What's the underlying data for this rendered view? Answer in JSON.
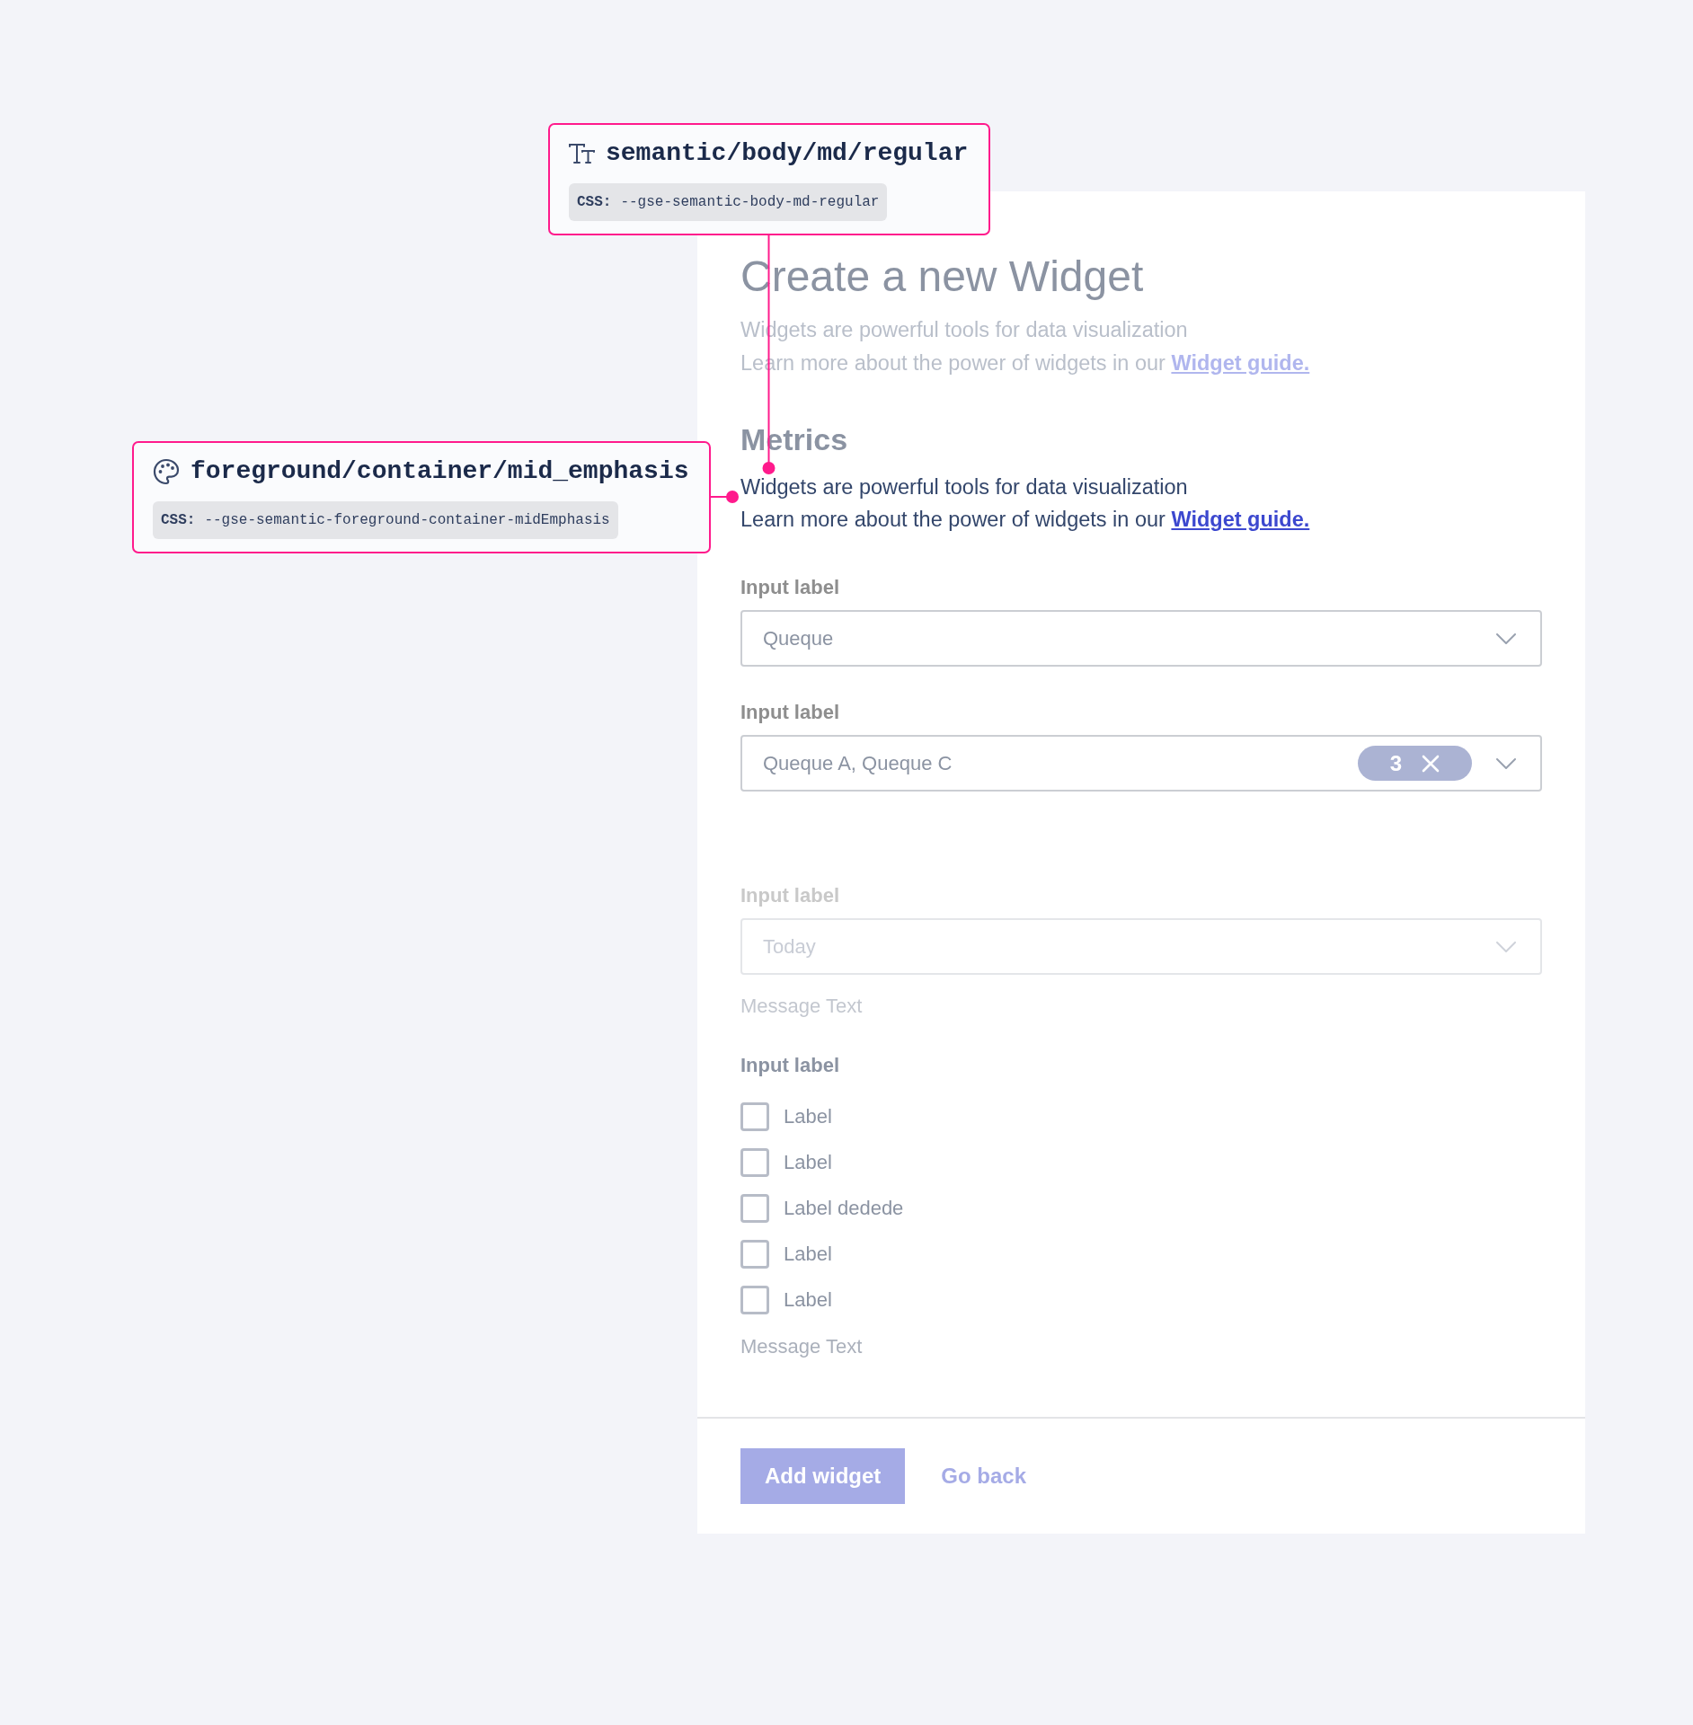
{
  "annotations": [
    {
      "kind": "typography",
      "title": "semantic/body/md/regular",
      "css_label": "CSS:",
      "css_value": "--gse-semantic-body-md-regular"
    },
    {
      "kind": "color",
      "title": "foreground/container/mid_emphasis",
      "css_label": "CSS:",
      "css_value": "--gse-semantic-foreground-container-midEmphasis"
    }
  ],
  "form": {
    "title": "Create a new Widget",
    "intro": {
      "muted": true,
      "line_1": "Widgets are powerful tools for data visualization",
      "line_2": "Learn more about the power of widgets in our",
      "link": "Widget guide."
    },
    "section_heading": "Metrics",
    "description": {
      "muted": false,
      "line_1": "Widgets are powerful tools for data visualization",
      "line_2": "Learn more about the power of widgets in our",
      "link": "Widget guide."
    },
    "fields": [
      {
        "kind": "select",
        "label": "Input label",
        "value": "Queque",
        "disabled": false
      },
      {
        "kind": "multiselect",
        "label": "Input label",
        "value": "Queque A, Queque C",
        "count": "3",
        "disabled": false
      },
      {
        "kind": "select",
        "label": "Input label",
        "value": "Today",
        "disabled": true,
        "message": "Message Text"
      },
      {
        "kind": "checkbox_group",
        "label": "Input label",
        "options": [
          {
            "label": "Label",
            "checked": false
          },
          {
            "label": "Label",
            "checked": false
          },
          {
            "label": "Label dedede",
            "checked": false
          },
          {
            "label": "Label",
            "checked": false
          },
          {
            "label": "Label",
            "checked": false
          }
        ],
        "message": "Message Text"
      }
    ],
    "buttons": [
      {
        "kind": "primary",
        "label": "Add widget"
      },
      {
        "kind": "link",
        "label": "Go back"
      }
    ]
  }
}
